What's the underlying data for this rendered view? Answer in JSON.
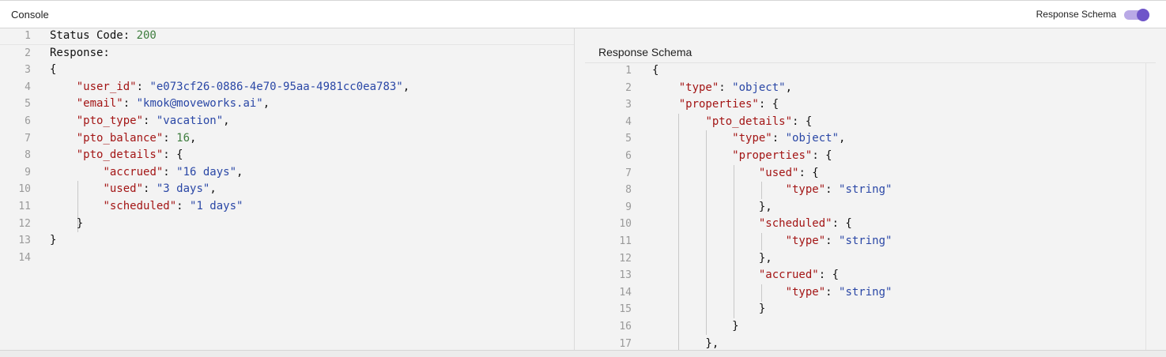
{
  "header": {
    "title": "Console",
    "toggle_label": "Response Schema",
    "toggle_on": true,
    "toggle_color": "#6f55c9"
  },
  "left_editor": {
    "lines": [
      {
        "n": "1",
        "tokens": [
          {
            "t": "Status Code: ",
            "c": ""
          },
          {
            "t": "200",
            "c": "n"
          }
        ]
      },
      {
        "n": "2",
        "tokens": [
          {
            "t": "Response:",
            "c": ""
          }
        ]
      },
      {
        "n": "3",
        "tokens": [
          {
            "t": "{",
            "c": ""
          }
        ]
      },
      {
        "n": "4",
        "tokens": [
          {
            "t": "    ",
            "c": ""
          },
          {
            "t": "\"user_id\"",
            "c": "k"
          },
          {
            "t": ": ",
            "c": ""
          },
          {
            "t": "\"e073cf26-0886-4e70-95aa-4981cc0ea783\"",
            "c": "s"
          },
          {
            "t": ",",
            "c": ""
          }
        ]
      },
      {
        "n": "5",
        "tokens": [
          {
            "t": "    ",
            "c": ""
          },
          {
            "t": "\"email\"",
            "c": "k"
          },
          {
            "t": ": ",
            "c": ""
          },
          {
            "t": "\"kmok@moveworks.ai\"",
            "c": "s"
          },
          {
            "t": ",",
            "c": ""
          }
        ]
      },
      {
        "n": "6",
        "tokens": [
          {
            "t": "    ",
            "c": ""
          },
          {
            "t": "\"pto_type\"",
            "c": "k"
          },
          {
            "t": ": ",
            "c": ""
          },
          {
            "t": "\"vacation\"",
            "c": "s"
          },
          {
            "t": ",",
            "c": ""
          }
        ]
      },
      {
        "n": "7",
        "tokens": [
          {
            "t": "    ",
            "c": ""
          },
          {
            "t": "\"pto_balance\"",
            "c": "k"
          },
          {
            "t": ": ",
            "c": ""
          },
          {
            "t": "16",
            "c": "n"
          },
          {
            "t": ",",
            "c": ""
          }
        ]
      },
      {
        "n": "8",
        "tokens": [
          {
            "t": "    ",
            "c": ""
          },
          {
            "t": "\"pto_details\"",
            "c": "k"
          },
          {
            "t": ": {",
            "c": ""
          }
        ]
      },
      {
        "n": "9",
        "tokens": [
          {
            "t": "        ",
            "c": ""
          },
          {
            "t": "\"accrued\"",
            "c": "k"
          },
          {
            "t": ": ",
            "c": ""
          },
          {
            "t": "\"16 days\"",
            "c": "s"
          },
          {
            "t": ",",
            "c": ""
          }
        ]
      },
      {
        "n": "10",
        "tokens": [
          {
            "t": "        ",
            "c": ""
          },
          {
            "t": "\"used\"",
            "c": "k"
          },
          {
            "t": ": ",
            "c": ""
          },
          {
            "t": "\"3 days\"",
            "c": "s"
          },
          {
            "t": ",",
            "c": ""
          }
        ]
      },
      {
        "n": "11",
        "tokens": [
          {
            "t": "        ",
            "c": ""
          },
          {
            "t": "\"scheduled\"",
            "c": "k"
          },
          {
            "t": ": ",
            "c": ""
          },
          {
            "t": "\"1 days\"",
            "c": "s"
          }
        ]
      },
      {
        "n": "12",
        "tokens": [
          {
            "t": "    }",
            "c": ""
          }
        ]
      },
      {
        "n": "13",
        "tokens": [
          {
            "t": "}",
            "c": ""
          }
        ]
      },
      {
        "n": "14",
        "tokens": []
      }
    ]
  },
  "right_editor": {
    "title": "Response Schema",
    "lines": [
      {
        "n": "1",
        "tokens": [
          {
            "t": "{",
            "c": ""
          }
        ]
      },
      {
        "n": "2",
        "tokens": [
          {
            "t": "    ",
            "c": ""
          },
          {
            "t": "\"type\"",
            "c": "k"
          },
          {
            "t": ": ",
            "c": ""
          },
          {
            "t": "\"object\"",
            "c": "s"
          },
          {
            "t": ",",
            "c": ""
          }
        ]
      },
      {
        "n": "3",
        "tokens": [
          {
            "t": "    ",
            "c": ""
          },
          {
            "t": "\"properties\"",
            "c": "k"
          },
          {
            "t": ": {",
            "c": ""
          }
        ]
      },
      {
        "n": "4",
        "tokens": [
          {
            "t": "        ",
            "c": ""
          },
          {
            "t": "\"pto_details\"",
            "c": "k"
          },
          {
            "t": ": {",
            "c": ""
          }
        ]
      },
      {
        "n": "5",
        "tokens": [
          {
            "t": "            ",
            "c": ""
          },
          {
            "t": "\"type\"",
            "c": "k"
          },
          {
            "t": ": ",
            "c": ""
          },
          {
            "t": "\"object\"",
            "c": "s"
          },
          {
            "t": ",",
            "c": ""
          }
        ]
      },
      {
        "n": "6",
        "tokens": [
          {
            "t": "            ",
            "c": ""
          },
          {
            "t": "\"properties\"",
            "c": "k"
          },
          {
            "t": ": {",
            "c": ""
          }
        ]
      },
      {
        "n": "7",
        "tokens": [
          {
            "t": "                ",
            "c": ""
          },
          {
            "t": "\"used\"",
            "c": "k"
          },
          {
            "t": ": {",
            "c": ""
          }
        ]
      },
      {
        "n": "8",
        "tokens": [
          {
            "t": "                    ",
            "c": ""
          },
          {
            "t": "\"type\"",
            "c": "k"
          },
          {
            "t": ": ",
            "c": ""
          },
          {
            "t": "\"string\"",
            "c": "s"
          }
        ]
      },
      {
        "n": "9",
        "tokens": [
          {
            "t": "                },",
            "c": ""
          }
        ]
      },
      {
        "n": "10",
        "tokens": [
          {
            "t": "                ",
            "c": ""
          },
          {
            "t": "\"scheduled\"",
            "c": "k"
          },
          {
            "t": ": {",
            "c": ""
          }
        ]
      },
      {
        "n": "11",
        "tokens": [
          {
            "t": "                    ",
            "c": ""
          },
          {
            "t": "\"type\"",
            "c": "k"
          },
          {
            "t": ": ",
            "c": ""
          },
          {
            "t": "\"string\"",
            "c": "s"
          }
        ]
      },
      {
        "n": "12",
        "tokens": [
          {
            "t": "                },",
            "c": ""
          }
        ]
      },
      {
        "n": "13",
        "tokens": [
          {
            "t": "                ",
            "c": ""
          },
          {
            "t": "\"accrued\"",
            "c": "k"
          },
          {
            "t": ": {",
            "c": ""
          }
        ]
      },
      {
        "n": "14",
        "tokens": [
          {
            "t": "                    ",
            "c": ""
          },
          {
            "t": "\"type\"",
            "c": "k"
          },
          {
            "t": ": ",
            "c": ""
          },
          {
            "t": "\"string\"",
            "c": "s"
          }
        ]
      },
      {
        "n": "15",
        "tokens": [
          {
            "t": "                }",
            "c": ""
          }
        ]
      },
      {
        "n": "16",
        "tokens": [
          {
            "t": "            }",
            "c": ""
          }
        ]
      },
      {
        "n": "17",
        "tokens": [
          {
            "t": "        },",
            "c": ""
          }
        ]
      }
    ]
  }
}
